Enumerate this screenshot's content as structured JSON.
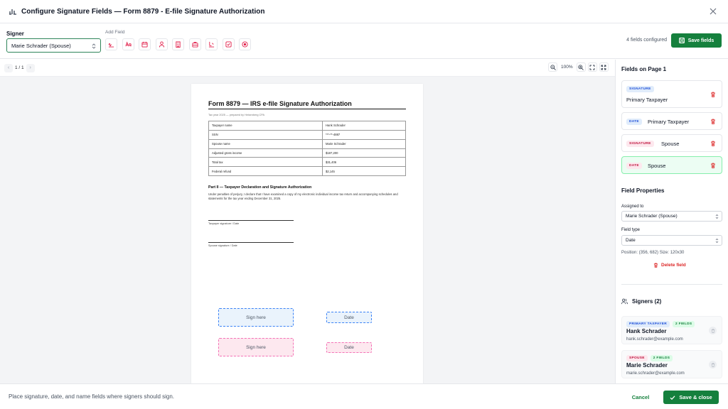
{
  "header": {
    "title": "Configure Signature Fields — Form 8879 - E-file Signature Authorization",
    "app_icon": "signature-icon",
    "close_icon": "close-icon"
  },
  "toolbar": {
    "signer_label": "Signer",
    "signer_value": "Marie Schrader (Spouse)",
    "add_field_label": "Add Field",
    "field_tools": [
      {
        "name": "signature-tool",
        "icon": "signature-icon"
      },
      {
        "name": "initials-tool",
        "icon": "initials-icon"
      },
      {
        "name": "date-tool",
        "icon": "calendar-icon"
      },
      {
        "name": "name-tool",
        "icon": "person-icon"
      },
      {
        "name": "company-tool",
        "icon": "building-icon"
      },
      {
        "name": "title-tool",
        "icon": "briefcase-icon"
      },
      {
        "name": "text-tool",
        "icon": "text-field-icon"
      },
      {
        "name": "checkbox-tool",
        "icon": "checkbox-icon"
      },
      {
        "name": "radio-tool",
        "icon": "radio-icon"
      }
    ],
    "fields_configured": "4 fields configured",
    "save_fields_label": "Save fields"
  },
  "viewer": {
    "page_indicator": "1 / 1",
    "zoom": "100%"
  },
  "document": {
    "title": "Form 8879 — IRS e-file Signature Authorization",
    "subtitle": "Tax year 2025 — prepared by Heisenberg CPA",
    "rows": [
      {
        "label": "Taxpayer name",
        "value": "Hank Schrader"
      },
      {
        "label": "SSN",
        "value": "***-**-4887"
      },
      {
        "label": "Spouse name",
        "value": "Marie Schrader"
      },
      {
        "label": "Adjusted gross income",
        "value": "$187,200"
      },
      {
        "label": "Total tax",
        "value": "$31,406"
      },
      {
        "label": "Federal refund",
        "value": "$2,145"
      }
    ],
    "part_title": "Part II — Taxpayer Declaration and Signature Authorization",
    "part_body": "Under penalties of perjury, I declare that I have examined a copy of my electronic individual income tax return and accompanying schedules and statements for the tax year ending December 31, 2025.",
    "taxpayer_sig_label": "Taxpayer signature / Date",
    "spouse_sig_label": "Spouse signature / Date",
    "placed_fields": {
      "sign_here_1": "Sign here",
      "date_1": "Date",
      "sign_here_2": "Sign here",
      "date_2": "Date"
    }
  },
  "sidebar": {
    "fields_heading": "Fields on Page 1",
    "fields": [
      {
        "badge": "SIGNATURE",
        "name": "Primary Taxpayer"
      },
      {
        "badge": "DATE",
        "name": "Primary Taxpayer"
      },
      {
        "badge": "SIGNATURE",
        "name": "Spouse"
      },
      {
        "badge": "DATE",
        "name": "Spouse"
      }
    ],
    "props_heading": "Field Properties",
    "assigned_label": "Assigned to",
    "assigned_value": "Marie Schrader (Spouse)",
    "type_label": "Field type",
    "type_value": "Date",
    "position_text": "Position: (356, 682)   Size: 120x30",
    "delete_label": "Delete field",
    "signers_heading": "Signers (2)",
    "signers": [
      {
        "role": "PRIMARY TAXPAYER",
        "count": "2 FIELDS",
        "name": "Hank Schrader",
        "email": "hank.schrader@example.com"
      },
      {
        "role": "SPOUSE",
        "count": "2 FIELDS",
        "name": "Marie Schrader",
        "email": "marie.schrader@example.com"
      }
    ]
  },
  "footer": {
    "hint": "Place signature, date, and name fields where signers should sign.",
    "cancel_label": "Cancel",
    "save_close_label": "Save & close"
  },
  "colors": {
    "primary_green": "#15803d",
    "signature_pink": "#be123c",
    "date_blue": "#1d4ed8"
  }
}
